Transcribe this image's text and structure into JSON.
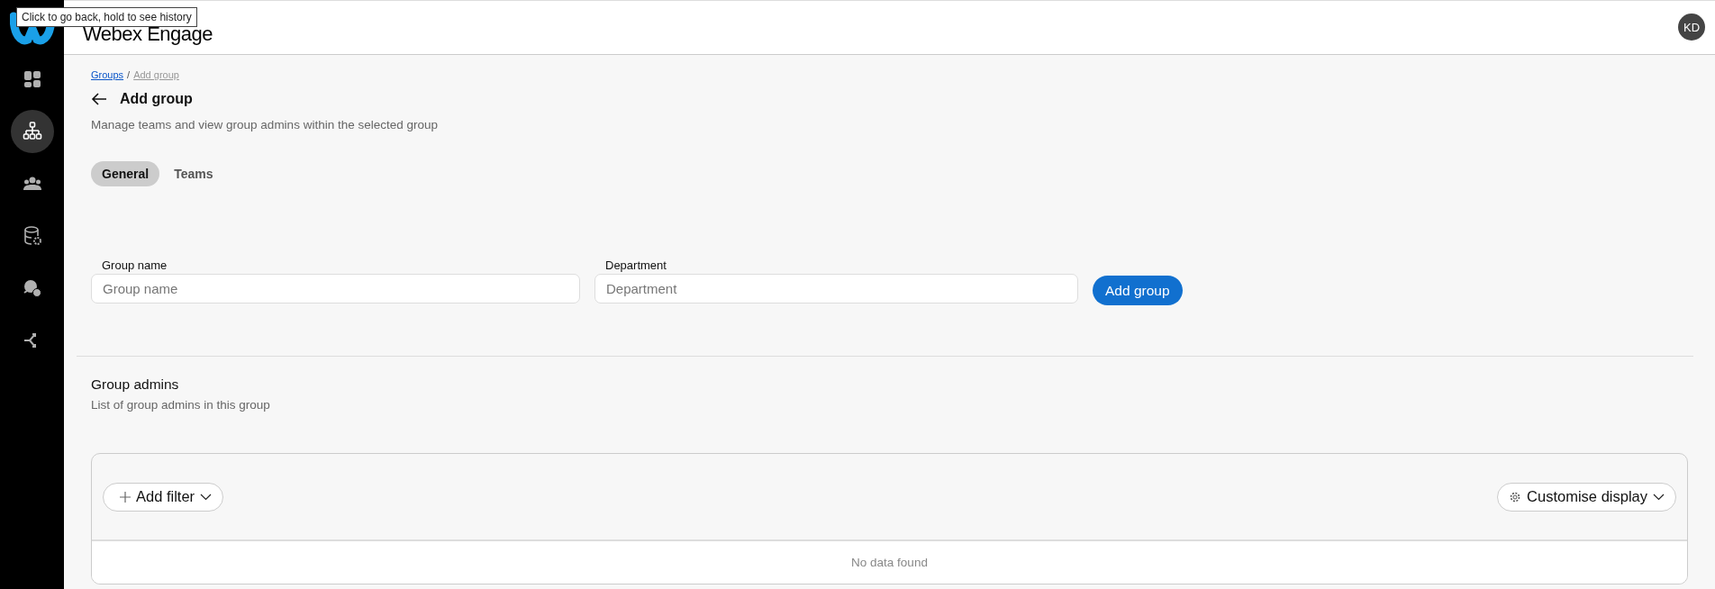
{
  "tooltip": {
    "text": "Click to go back, hold to see history"
  },
  "header": {
    "title": "Webex Engage",
    "avatar": "KD"
  },
  "sidebar": {
    "items": [
      {
        "selected": false
      },
      {
        "selected": true
      },
      {
        "selected": false
      },
      {
        "selected": false
      },
      {
        "selected": false
      },
      {
        "selected": false
      }
    ]
  },
  "breadcrumb": [
    {
      "label": "Groups",
      "current": false
    },
    {
      "label": "Add group",
      "current": true
    }
  ],
  "breadcrumb_separator": "/",
  "page": {
    "title": "Add group",
    "description": "Manage teams and view group admins within the selected group"
  },
  "tabs": [
    {
      "label": "General",
      "selected": true
    },
    {
      "label": "Teams",
      "selected": false
    }
  ],
  "form": {
    "fields": [
      {
        "label": "Group name",
        "placeholder": "Group name"
      },
      {
        "label": "Department",
        "placeholder": "Department"
      }
    ],
    "submit": "Add group"
  },
  "admins": {
    "title": "Group admins",
    "description": "List of group admins in this group",
    "add_filter": "Add filter",
    "customise": "Customise display",
    "empty": "No data found"
  }
}
